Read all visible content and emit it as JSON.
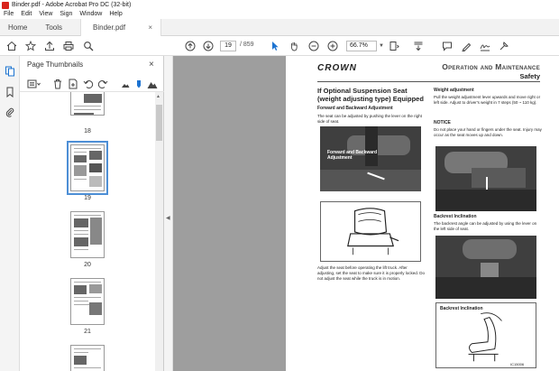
{
  "window": {
    "title": "Binder.pdf - Adobe Acrobat Pro DC (32-bit)"
  },
  "menu": [
    "File",
    "Edit",
    "View",
    "Sign",
    "Window",
    "Help"
  ],
  "tabs": {
    "home": "Home",
    "tools": "Tools",
    "doc": "Binder.pdf",
    "close": "×"
  },
  "toolbar": {
    "page_current": "19",
    "page_total": "/ 859",
    "zoom": "66.7%"
  },
  "panel": {
    "title": "Page Thumbnails",
    "close": "×",
    "thumbs": [
      {
        "label": "18"
      },
      {
        "label": "19",
        "selected": true
      },
      {
        "label": "20"
      },
      {
        "label": "21"
      },
      {
        "label": ""
      }
    ]
  },
  "doc": {
    "logo": "CROWN",
    "header_title": "Operation and Maintenance",
    "header_sub": "Safety",
    "main_heading": "If Optional Suspension Seat (weight adjusting type) Equipped",
    "fwd_heading": "Forward and Backward Adjustment",
    "fwd_text": "The seat can be adjusted by pushing the lever on the right side of seat.",
    "photo1_caption": "Forward and Backward Adjustment",
    "adjust_text": "Adjust the seat before operating the lift truck. After adjusting, set the seat to make sure it is properly locked. Do not adjust the seat while the truck is in motion.",
    "weight_heading": "Weight adjustment",
    "weight_text": "Pull the weight adjustment lever upwards and move right or left side. Adjust to driver's weight in 7 steps (50 ~ 110 kg).",
    "notice_heading": "NOTICE",
    "notice_text": "Do not place your hand or fingers under the seat. Injury may occur as the seat moves up and down.",
    "backrest_heading": "Backrest Inclination",
    "backrest_text": "The backrest angle can be adjusted by using the lever on the left side of seat.",
    "drawing_caption": "Backrest Inclination",
    "drawing_ref": "IC15006"
  },
  "icons": [
    "home-icon",
    "star-icon",
    "upload-icon",
    "print-icon",
    "search-icon",
    "prev-page-icon",
    "next-page-icon",
    "cursor-icon",
    "hand-icon",
    "zoom-out-icon",
    "zoom-in-icon",
    "fit-icon",
    "scroll-icon",
    "comment-icon",
    "sign-icon",
    "highlight-icon"
  ]
}
